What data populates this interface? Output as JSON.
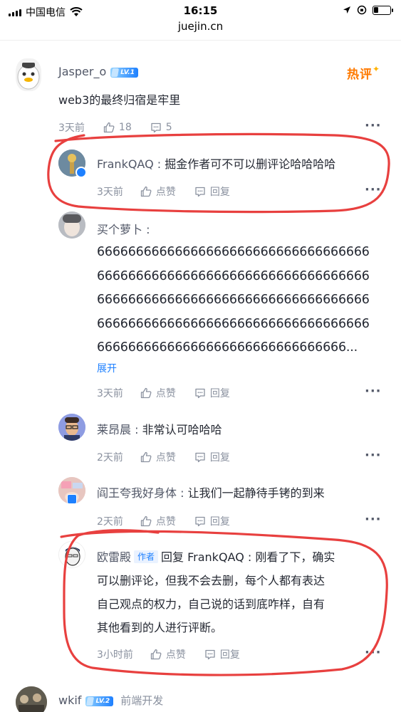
{
  "status_bar": {
    "carrier": "中国电信",
    "time": "16:15",
    "url": "juejin.cn"
  },
  "comment": {
    "author": "Jasper_o",
    "level": "LV.1",
    "hot_badge": "热评",
    "content": "web3的最终归宿是牢里",
    "time": "3天前",
    "likes": "18",
    "replies": "5"
  },
  "replies": [
    {
      "author": "FrankQAQ",
      "content": "掘金作者可不可以删评论哈哈哈哈",
      "time": "3天前",
      "like_label": "点赞",
      "reply_label": "回复"
    },
    {
      "author": "买个萝卜",
      "content_lines": [
        "66666666666666666666666666666666666",
        "66666666666666666666666666666666666",
        "66666666666666666666666666666666666",
        "66666666666666666666666666666666666",
        "66666666666666666666666666666666..."
      ],
      "expand": "展开",
      "time": "3天前",
      "like_label": "点赞",
      "reply_label": "回复"
    },
    {
      "author": "莱昂晨",
      "content": "非常认可哈哈哈",
      "time": "2天前",
      "like_label": "点赞",
      "reply_label": "回复"
    },
    {
      "author": "阎王夸我好身体",
      "content": "让我们一起静待手铐的到来",
      "time": "2天前",
      "like_label": "点赞",
      "reply_label": "回复"
    },
    {
      "author": "欧雷殿",
      "author_tag": "作者",
      "reply_to": "回复 FrankQAQ",
      "content_lines": [
        "刚看了下，确实",
        "可以删评论，但我不会去删，每个人都有表达",
        "自己观点的权力，自己说的话到底咋样，自有",
        "其他看到的人进行评断。"
      ],
      "time": "3小时前",
      "like_label": "点赞",
      "reply_label": "回复"
    }
  ],
  "next_comment": {
    "author": "wkif",
    "level": "LV.2",
    "job": "前端开发"
  },
  "colors": {
    "accent": "#1e80ff",
    "annotation": "#e8403f",
    "hot": "#ff7a00"
  },
  "icons": [
    "wifi-icon",
    "location-icon",
    "orientation-lock-icon",
    "battery-icon",
    "thumbs-up-icon",
    "comment-icon",
    "more-icon"
  ]
}
